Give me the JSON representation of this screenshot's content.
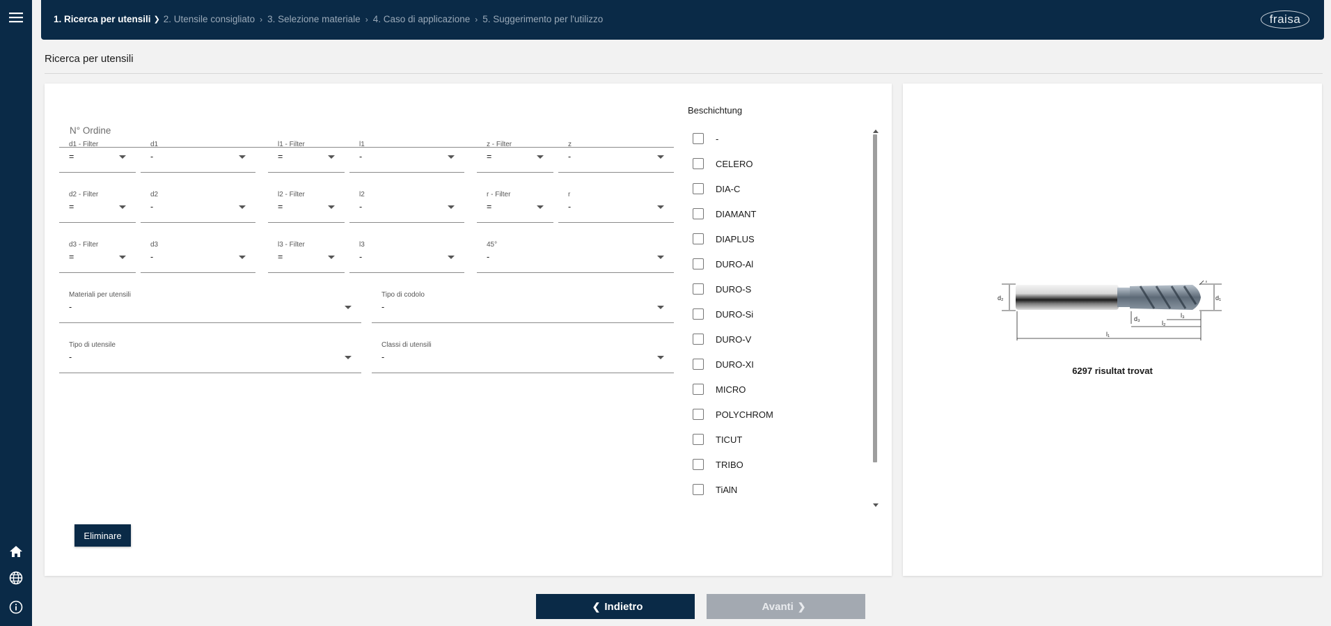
{
  "nav": {
    "steps": [
      {
        "label": "1. Ricerca per utensili"
      },
      {
        "label": "2. Utensile consigliato"
      },
      {
        "label": "3. Selezione materiale"
      },
      {
        "label": "4. Caso di applicazione"
      },
      {
        "label": "5. Suggerimento per l'utilizzo"
      }
    ],
    "logo": "fraisa"
  },
  "page": {
    "title": "Ricerca per utensili"
  },
  "form": {
    "order_placeholder": "N° Ordine",
    "rows": [
      [
        {
          "label": "d1 - Filter",
          "value": "="
        },
        {
          "label": "d1",
          "value": "-"
        },
        {
          "label": "l1 - Filter",
          "value": "="
        },
        {
          "label": "l1",
          "value": "-"
        },
        {
          "label": "z - Filter",
          "value": "="
        },
        {
          "label": "z",
          "value": "-"
        }
      ],
      [
        {
          "label": "d2 - Filter",
          "value": "="
        },
        {
          "label": "d2",
          "value": "-"
        },
        {
          "label": "l2 - Filter",
          "value": "="
        },
        {
          "label": "l2",
          "value": "-"
        },
        {
          "label": "r - Filter",
          "value": "="
        },
        {
          "label": "r",
          "value": "-"
        }
      ],
      [
        {
          "label": "d3 - Filter",
          "value": "="
        },
        {
          "label": "d3",
          "value": "-"
        },
        {
          "label": "l3 - Filter",
          "value": "="
        },
        {
          "label": "l3",
          "value": "-"
        },
        {
          "label": "45°",
          "value": "-"
        }
      ],
      [
        {
          "label": "Materiali per utensili",
          "value": "-"
        },
        {
          "label": "Tipo di codolo",
          "value": "-"
        }
      ],
      [
        {
          "label": "Tipo di utensile",
          "value": "-"
        },
        {
          "label": "Classi di utensili",
          "value": "-"
        }
      ]
    ],
    "clear_label": "Eliminare"
  },
  "coating": {
    "title": "Beschichtung",
    "items": [
      "-",
      "CELERO",
      "DIA-C",
      "DIAMANT",
      "DIAPLUS",
      "DURO-Al",
      "DURO-S",
      "DURO-Si",
      "DURO-V",
      "DURO-XI",
      "MICRO",
      "POLYCHROM",
      "TICUT",
      "TRIBO",
      "TiAlN"
    ]
  },
  "result": {
    "count_text": "6297 risultat trovat",
    "drawing_labels": {
      "d2": "d₂",
      "d1": "d₁",
      "d3": "d₃",
      "l1": "l₁",
      "l2": "l₂",
      "l3": "l₃",
      "r": "r"
    }
  },
  "footer": {
    "back_label": "Indietro",
    "next_label": "Avanti"
  },
  "colors": {
    "brand": "#0a2a47",
    "disabled": "#a3a9b1"
  }
}
